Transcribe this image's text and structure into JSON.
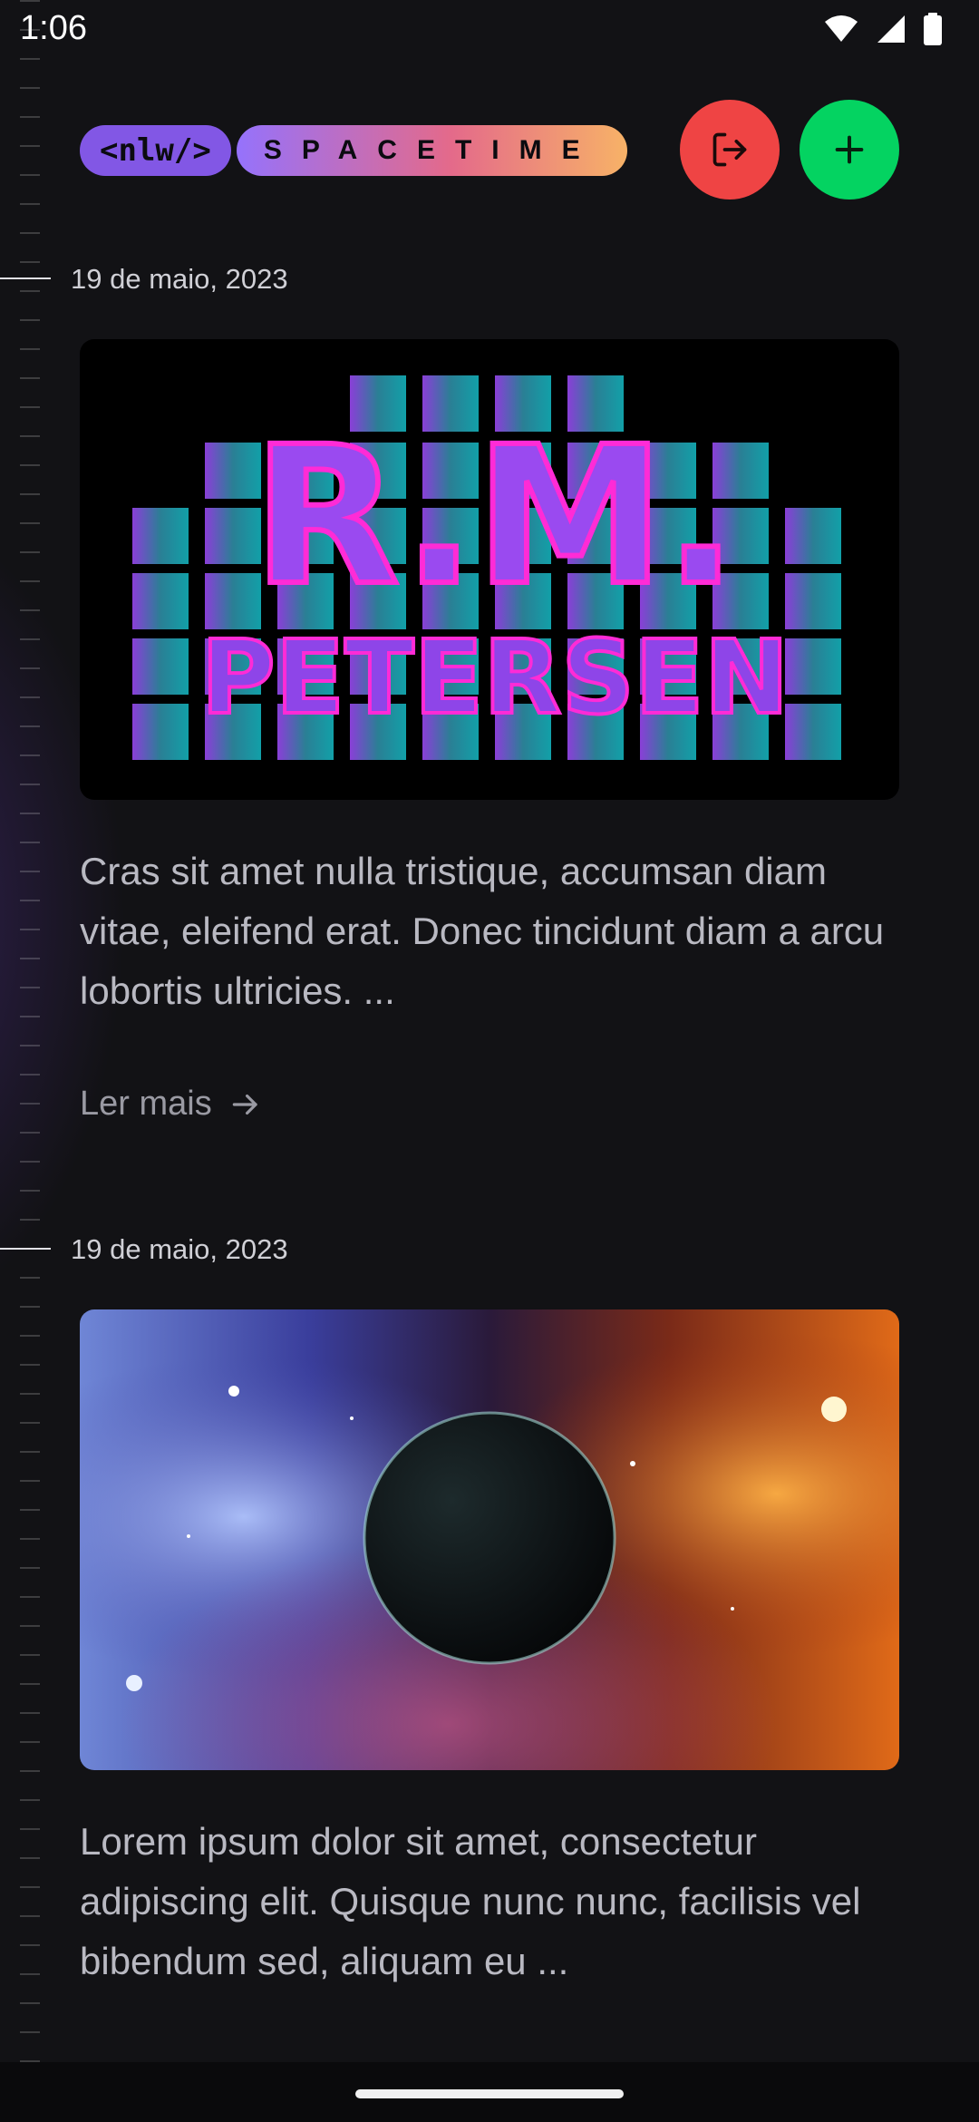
{
  "status": {
    "time": "1:06"
  },
  "header": {
    "logo_left": "<nlw/>",
    "logo_right": "SPACETIME",
    "logout_label": "logout",
    "add_label": "add memory"
  },
  "memories": [
    {
      "date": "19 de maio, 2023",
      "image_title": "R.M.",
      "image_subtitle": "PETERSEN",
      "excerpt": "Cras sit amet nulla tristique, accumsan diam vitae, eleifend erat. Donec tincidunt diam a arcu lobortis ultricies. ...",
      "read_more": "Ler mais"
    },
    {
      "date": "19 de maio, 2023",
      "excerpt": "Lorem ipsum dolor sit amet, consectetur adipiscing elit. Quisque nunc nunc, facilisis vel bibendum sed, aliquam eu ..."
    }
  ],
  "colors": {
    "background": "#121215",
    "logout": "#ef4444",
    "add": "#04d361",
    "brand_purple": "#8257e5"
  }
}
